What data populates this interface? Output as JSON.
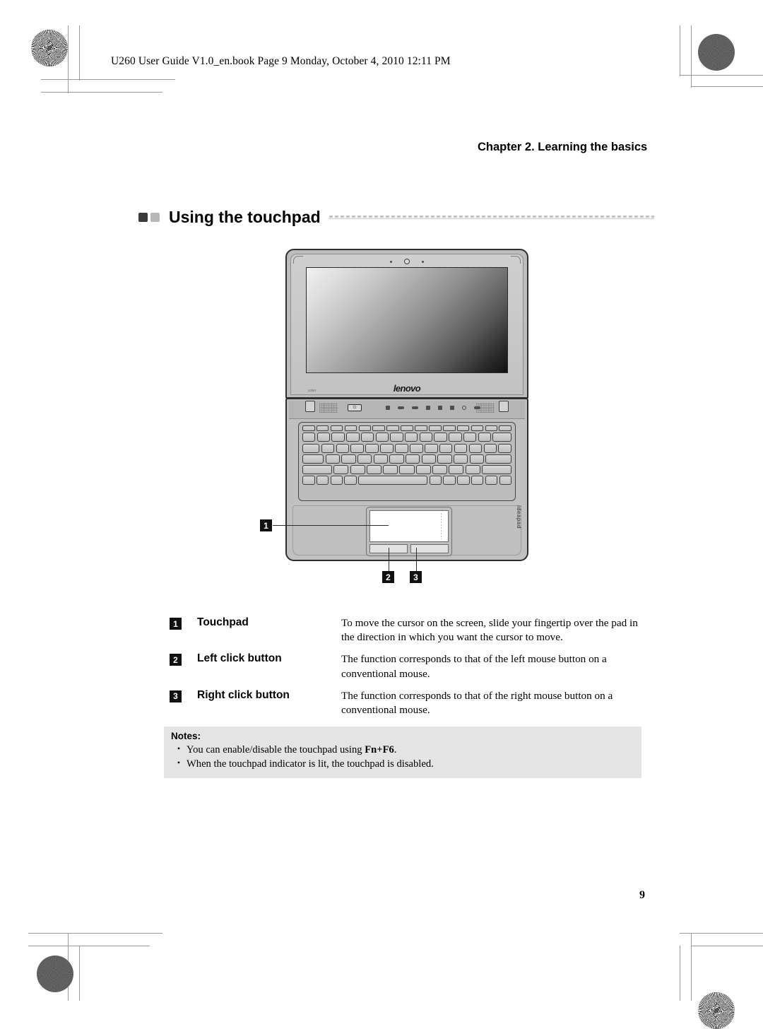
{
  "page": {
    "file_header": "U260 User Guide V1.0_en.book  Page 9  Monday, October 4, 2010  12:11 PM",
    "chapter": "Chapter 2. Learning the basics",
    "section_title": "Using the touchpad",
    "page_number": "9"
  },
  "illustration": {
    "lid_model_label": "U260",
    "brand_logo": "lenovo",
    "base_brand_label": "ideapad",
    "power_icon": "⏻",
    "callouts": [
      {
        "number": "1"
      },
      {
        "number": "2"
      },
      {
        "number": "3"
      }
    ]
  },
  "definitions": [
    {
      "number": "1",
      "term": "Touchpad",
      "description": "To move the cursor on the screen, slide your fingertip over the pad in the direction in which you want the cursor to move."
    },
    {
      "number": "2",
      "term": "Left click button",
      "description": "The function corresponds to that of the left mouse button on a conventional mouse."
    },
    {
      "number": "3",
      "term": "Right click button",
      "description": "The function corresponds to that of the right mouse button on a conventional mouse."
    }
  ],
  "notes": {
    "title": "Notes:",
    "bullet": "•",
    "items": [
      {
        "prefix": "You can enable/disable the touchpad using ",
        "key": "Fn+F6",
        "suffix": "."
      },
      {
        "prefix": "When the touchpad indicator is lit, the touchpad is disabled.",
        "key": "",
        "suffix": ""
      }
    ]
  },
  "colors": {
    "note_background": "#e4e4e4",
    "marker_background": "#111111",
    "bullet_dark": "#3a3a3a",
    "bullet_light": "#b7b7b7",
    "rule": "#c2c2c2"
  }
}
